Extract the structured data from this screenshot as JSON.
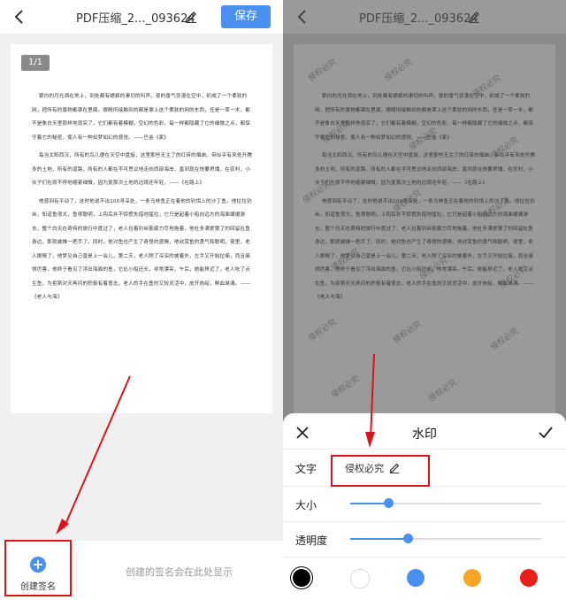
{
  "header": {
    "title": "PDF压缩_2..._093624",
    "save_label": "保存"
  },
  "document": {
    "page_indicator": "1/1",
    "paragraphs": [
      "银白的月光洒在地上，到处都有蟋蟀的凄切的叫声，夜的香气弥漫在空中，织成了一个柔软的网，把所有的景物都罩在里面。眼睛所接触到的都是罩上这个柔软的网的东西，任是一草一木，都不是象白天里那样地现实了，它们都有着模糊，空幻的色彩，每一样都隐藏了它的细微之点，都保守着它的秘密，使人有一种如梦如幻的感觉。——巴金《家》",
      "每当太阳西沉，所有的鸟儿便在天空中盘旋，这里那些无主了的红砖的烟囱，带似乎有来处升腾多的土地，所有的道路，所有的人都在不可思议地走向西部海岸，直到现在快要坍塌，在农村，小伙子们在原不停地缩紧细微，因为复那次土地的边境还年轻，——《在路上》",
      "他感到有平动了，这时他说不出100寻深处，一条马林鱼正在着他的钓饵上的沙丁鱼。他拉拉钓丝，知道鱼很大，鱼很聪明，上钩后并不惊慌失措地猛拉，它只是起着小船向远方的海面缓缓游去，整个白天在奇特的旅行中度过了，老人拉着钓丝筋疲力尽地拖着，他杜多满爱狠了的回留在鱼身边，那就被推一把手了。同时，他对鱼也产生了奇怪的感情，他欣赏鱼的勇气和聪明，夜里，老人眼睛了，他梦见自己曾是上一会儿，第二天，老人除了深深的披着外，左手又开始拉痛，而且痛得厉害，他终于看见了浮出海面的鱼，它比小船还长，非常漂亮，午后，她能移近了，老人吃了点生鱼，为拒斯对天再闪的积极有着意志，老人的手在鱼的又较灵活中，皮开肉绽，鲜血淋漓。——《老人与海》"
    ],
    "watermark_text": "侵权必究"
  },
  "bottom_bar": {
    "create_label": "创建签名",
    "plus_glyph": "+",
    "hint": "创建的签名会在此处显示"
  },
  "watermark_sheet": {
    "title": "水印",
    "text_label": "文字",
    "text_value": "侵权必究",
    "size_label": "大小",
    "size_value": 0.2,
    "opacity_label": "透明度",
    "opacity_value": 0.3,
    "colors": [
      "#000000",
      "#ffffff",
      "#4a90f0",
      "#f5a623",
      "#e62117"
    ],
    "selected_color": "#000000"
  },
  "annotation_color": "#d9141b"
}
